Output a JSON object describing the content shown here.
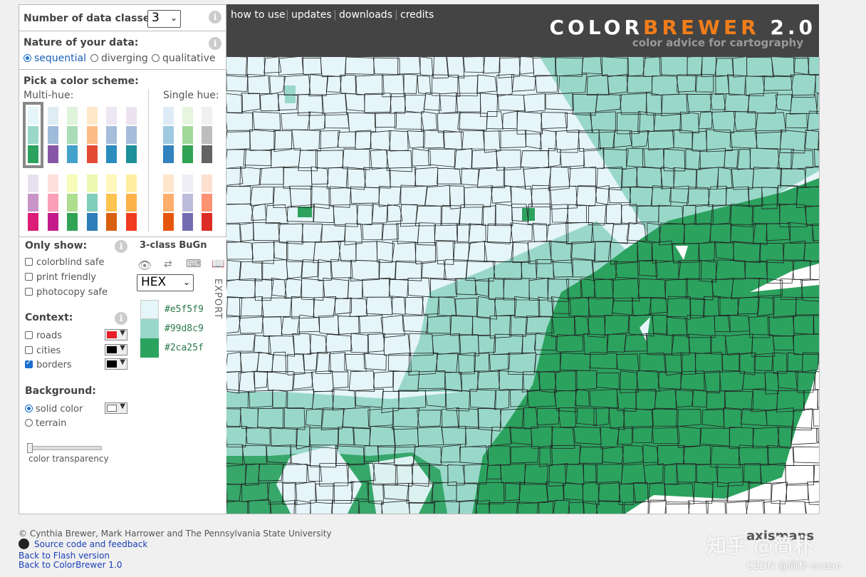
{
  "header": {
    "brand_part1": "COLOR",
    "brand_part2": "BREWER",
    "brand_version": "2.0",
    "tagline": "color advice for cartography",
    "nav": [
      "how to use",
      "updates",
      "downloads",
      "credits"
    ]
  },
  "sidebar": {
    "num_classes_label": "Number of data classes:",
    "num_classes_value": "3",
    "nature_label": "Nature of your data:",
    "nature_options": [
      "sequential",
      "diverging",
      "qualitative"
    ],
    "nature_selected": "sequential",
    "pick_label": "Pick a color scheme:",
    "multi_hue_label": "Multi-hue:",
    "single_hue_label": "Single hue:",
    "info_glyph": "i"
  },
  "multi_hue_schemes": [
    [
      "#e5f5f9",
      "#99d8c9",
      "#2ca25f"
    ],
    [
      "#e0ecf4",
      "#9ebcda",
      "#8856a7"
    ],
    [
      "#e0f3db",
      "#a8ddb5",
      "#43a2ca"
    ],
    [
      "#fee8c8",
      "#fdbb84",
      "#e34a33"
    ],
    [
      "#ece7f2",
      "#a6bddb",
      "#2b8cbe"
    ],
    [
      "#ece2f0",
      "#a6bddb",
      "#1c9099"
    ],
    [
      "#e7e1ef",
      "#c994c7",
      "#dd1c77"
    ],
    [
      "#fde0dd",
      "#fa9fb5",
      "#c51b8a"
    ],
    [
      "#f7fcb9",
      "#addd8e",
      "#31a354"
    ],
    [
      "#edf8b1",
      "#7fcdbb",
      "#2c7fb8"
    ],
    [
      "#fff7bc",
      "#fec44f",
      "#d95f0e"
    ],
    [
      "#ffeda0",
      "#feb24c",
      "#f03b20"
    ]
  ],
  "single_hue_schemes": [
    [
      "#deebf7",
      "#9ecae1",
      "#3182bd"
    ],
    [
      "#e5f5e0",
      "#a1d99b",
      "#31a354"
    ],
    [
      "#f0f0f0",
      "#bdbdbd",
      "#636363"
    ],
    [
      "#fee6ce",
      "#fdae6b",
      "#e6550d"
    ],
    [
      "#efedf5",
      "#bcbddc",
      "#756bb1"
    ],
    [
      "#fee0d2",
      "#fc9272",
      "#de2d26"
    ]
  ],
  "filters": {
    "only_show_label": "Only show:",
    "options": [
      {
        "label": "colorblind safe",
        "checked": false
      },
      {
        "label": "print friendly",
        "checked": false
      },
      {
        "label": "photocopy safe",
        "checked": false
      }
    ]
  },
  "context": {
    "label": "Context:",
    "items": [
      {
        "label": "roads",
        "checked": false,
        "color": "#e8202a"
      },
      {
        "label": "cities",
        "checked": false,
        "color": "#000000"
      },
      {
        "label": "borders",
        "checked": true,
        "color": "#000000"
      }
    ]
  },
  "background": {
    "label": "Background:",
    "options": [
      "solid color",
      "terrain"
    ],
    "selected": "solid color",
    "solid_color": "#ffffff",
    "transparency_label": "color transparency"
  },
  "scheme_detail": {
    "title": "3-class BuGn",
    "format": "HEX",
    "export_label": "EXPORT",
    "colors": [
      {
        "hex": "#e5f5f9",
        "label": "#e5f5f9"
      },
      {
        "hex": "#99d8c9",
        "label": "#99d8c9"
      },
      {
        "hex": "#2ca25f",
        "label": "#2ca25f"
      }
    ]
  },
  "footer": {
    "copyright": "© Cynthia Brewer, Mark Harrower and The Pennsylvania State University",
    "source_link": "Source code and feedback",
    "flash_link": "Back to Flash version",
    "cb1_link": "Back to ColorBrewer 1.0",
    "logo_text": "axismaps",
    "watermark": "知乎 @简朴",
    "watermark2": "CSDN @简朴-ocean"
  }
}
